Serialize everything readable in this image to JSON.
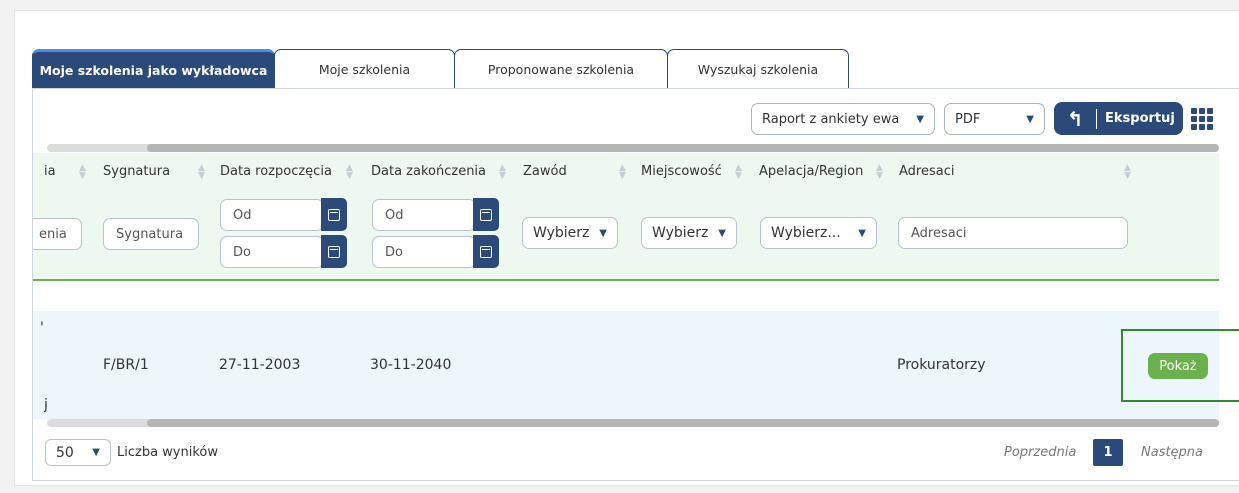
{
  "tabs": [
    {
      "label": "Moje szkolenia jako wykładowca"
    },
    {
      "label": "Moje szkolenia"
    },
    {
      "label": "Proponowane szkolenia"
    },
    {
      "label": "Wyszukaj szkolenia"
    }
  ],
  "toolbar": {
    "report_select": "Raport z ankiety ewa",
    "format_select": "PDF",
    "export_label": "Eksportuj"
  },
  "columns": [
    "ia",
    "Sygnatura",
    "Data rozpoczęcia",
    "Data zakończenia",
    "Zawód",
    "Miejscowość",
    "Apelacja/Region",
    "Adresaci"
  ],
  "filters": {
    "cut_placeholder": "enia",
    "sygnatura_placeholder": "Sygnatura",
    "date_from": "Od",
    "date_to": "Do",
    "zawod": "Wybierz",
    "miejscowosc": "Wybierz",
    "apelacja": "Wybierz...",
    "adresaci_placeholder": "Adresaci"
  },
  "row": {
    "mark_top": "'",
    "mark_bottom": "j",
    "sygnatura": "F/BR/1",
    "start": "27-11-2003",
    "end": "30-11-2040",
    "adresaci": "Prokuratorzy",
    "show_label": "Pokaż"
  },
  "footer": {
    "per_page": "50",
    "per_page_label": "Liczba wyników",
    "prev": "Poprzednia",
    "current_page": "1",
    "next": "Następna"
  },
  "colors": {
    "primary": "#2b4a7a",
    "accent_green": "#6ab04c",
    "highlight": "#2e8b2e"
  },
  "icons": [
    "back-arrow-icon",
    "grid-icon",
    "calendar-icon",
    "chevron-down-icon",
    "sort-icon"
  ]
}
